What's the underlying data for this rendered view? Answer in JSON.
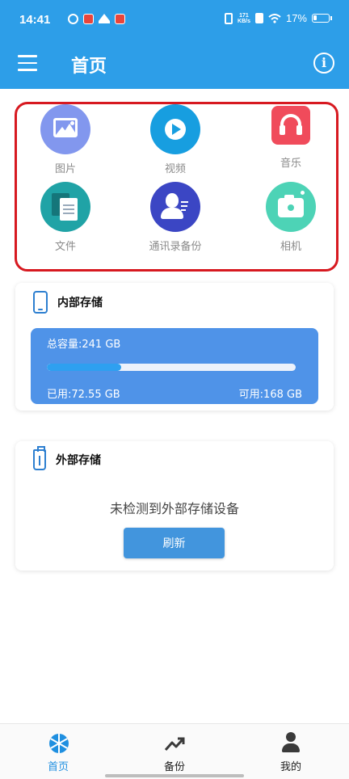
{
  "status_bar": {
    "time": "14:41",
    "net_rate_top": "171",
    "net_rate_unit": "KB/s",
    "battery": "17%"
  },
  "app_bar": {
    "title": "首页",
    "menu_icon": "hamburger-menu-icon",
    "info_icon": "info-icon",
    "info_glyph": "i"
  },
  "categories": [
    {
      "label": "图片",
      "icon": "image-icon",
      "color": "#8297ee"
    },
    {
      "label": "视频",
      "icon": "play-icon",
      "color": "#179ee0"
    },
    {
      "label": "音乐",
      "icon": "headphones-icon",
      "color": "#f04b5b"
    },
    {
      "label": "文件",
      "icon": "document-icon",
      "color": "#20a3a6"
    },
    {
      "label": "通讯录备份",
      "icon": "contacts-icon",
      "color": "#3b46c4"
    },
    {
      "label": "相机",
      "icon": "camera-icon",
      "color": "#4dd3b6"
    }
  ],
  "internal_storage": {
    "title": "内部存储",
    "total": "总容量:241 GB",
    "used": "已用:72.55 GB",
    "available": "可用:168 GB",
    "used_fraction": 0.3
  },
  "external_storage": {
    "title": "外部存储",
    "message": "未检测到外部存储设备",
    "refresh_label": "刷新"
  },
  "bottom_nav": [
    {
      "label": "首页",
      "icon": "aperture-icon",
      "active": true
    },
    {
      "label": "备份",
      "icon": "trending-up-icon",
      "active": false
    },
    {
      "label": "我的",
      "icon": "person-icon",
      "active": false
    }
  ],
  "colors": {
    "primary": "#2d9ee8",
    "highlight_border": "#d71920",
    "storage_panel": "#4f93e8",
    "active_nav": "#1f8fe0"
  }
}
